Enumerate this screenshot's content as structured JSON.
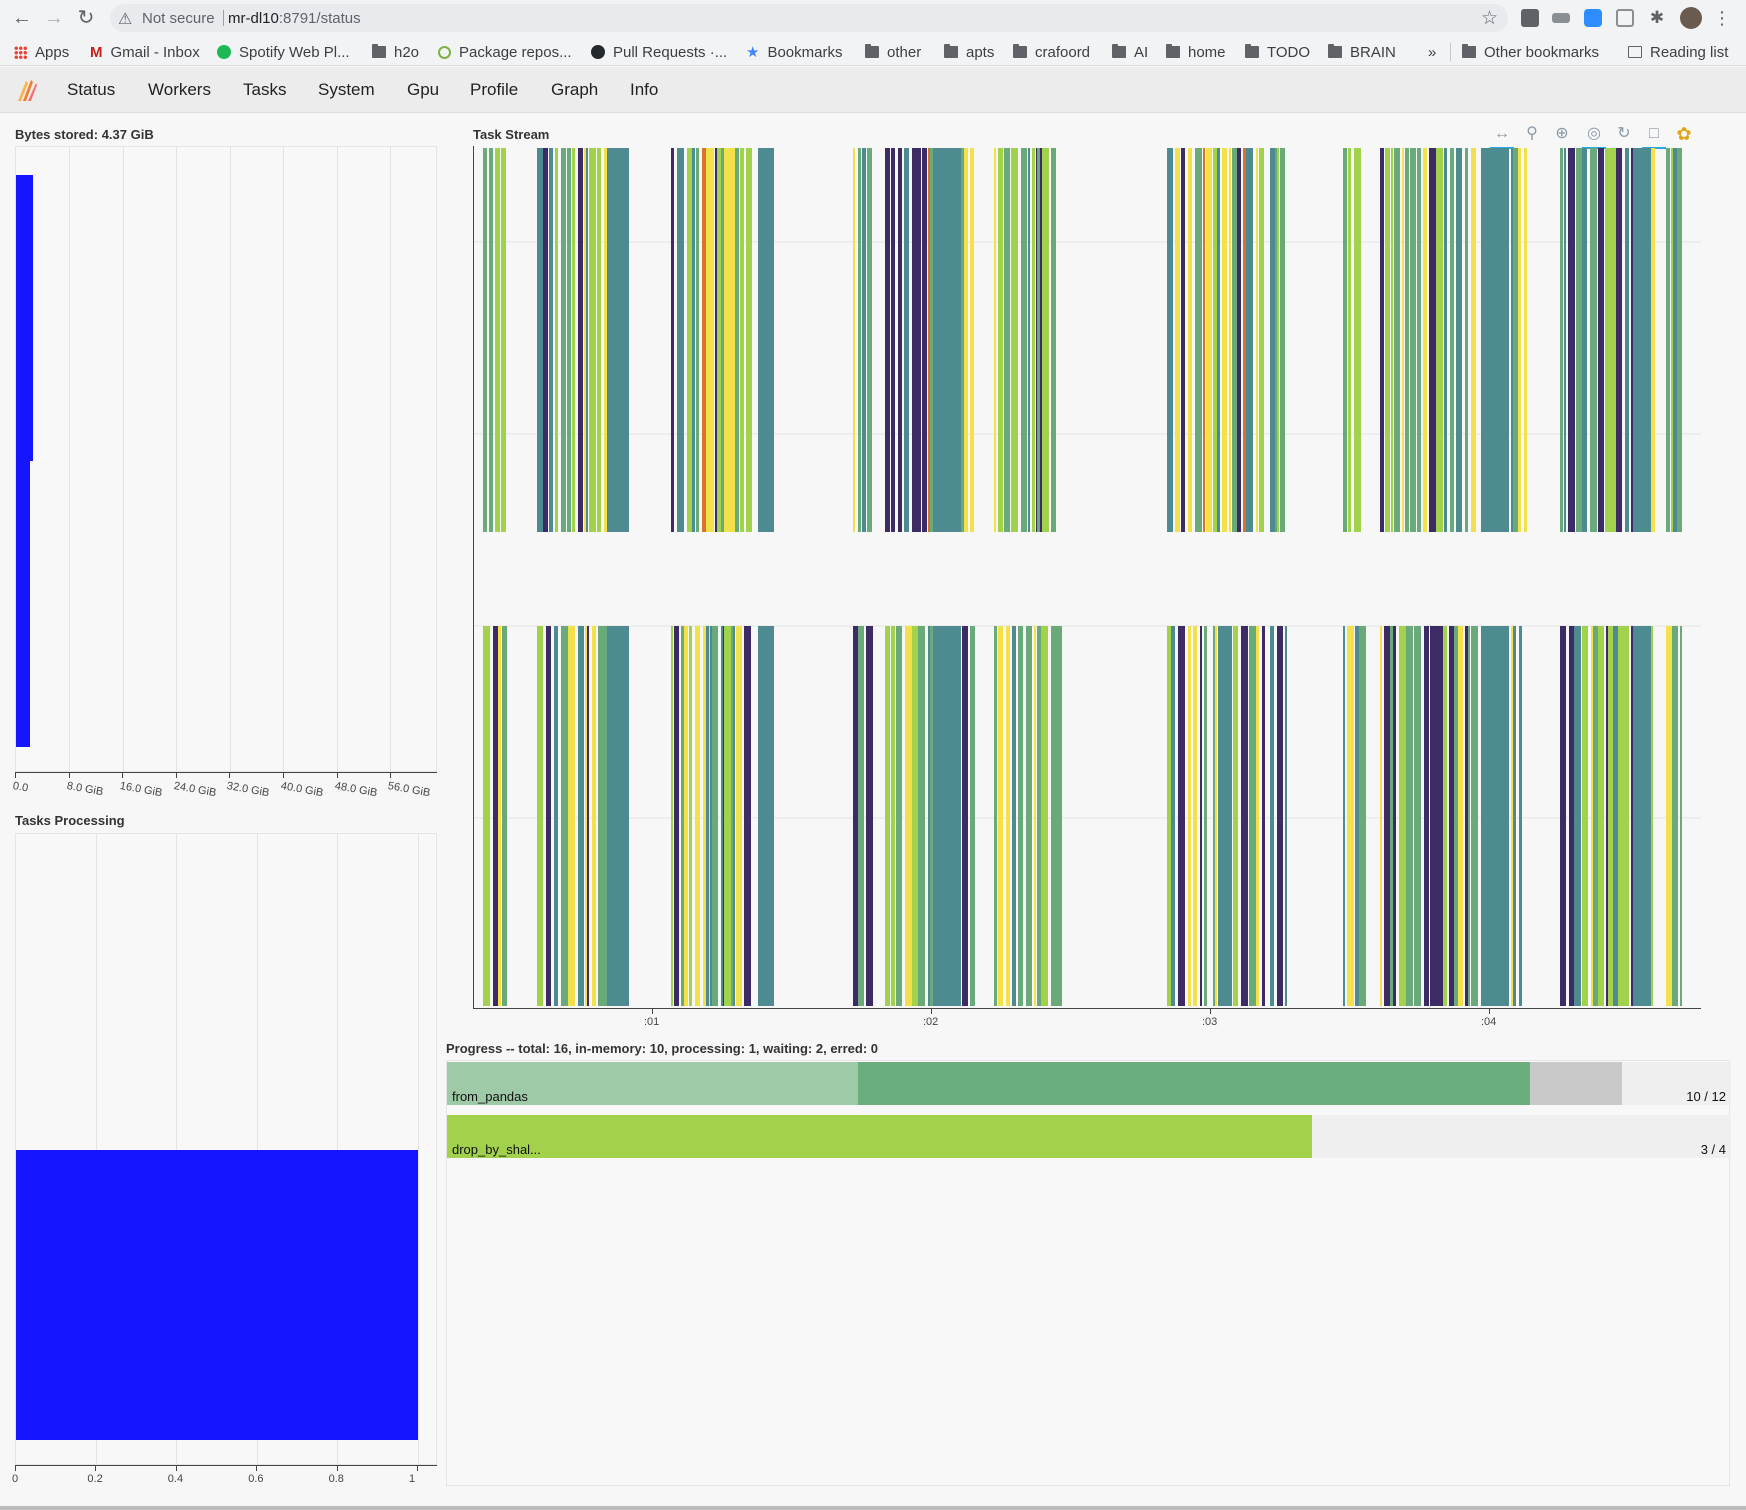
{
  "browser": {
    "back_icon": "back-arrow-icon",
    "warning_label": "Not secure",
    "url_host": "mr-dl10",
    "url_rest": ":8791/status"
  },
  "bookmarks": {
    "items": [
      "Apps",
      "Gmail - Inbox",
      "Spotify Web Pl...",
      "h2o",
      "Package repos...",
      "Pull Requests ·...",
      "Bookmarks",
      "other",
      "apts",
      "crafoord",
      "AI",
      "home",
      "TODO",
      "BRAIN"
    ],
    "overflow": "»",
    "other": "Other bookmarks",
    "reading_list": "Reading list"
  },
  "dask_nav": [
    "Status",
    "Workers",
    "Tasks",
    "System",
    "Gpu",
    "Profile",
    "Graph",
    "Info"
  ],
  "bytes_stored": {
    "title": "Bytes stored: 4.37 GiB",
    "ticks": [
      "0.0",
      "8.0 GiB",
      "16.0 GiB",
      "24.0 GiB",
      "32.0 GiB",
      "40.0 GiB",
      "48.0 GiB",
      "56.0 GiB"
    ],
    "bar_color": "#1515ff"
  },
  "tasks_processing": {
    "title": "Tasks Processing",
    "ticks": [
      "0",
      "0.2",
      "0.4",
      "0.6",
      "0.8",
      "1"
    ],
    "value": 1,
    "bar_color": "#1515ff"
  },
  "task_stream": {
    "title": "Task Stream",
    "ticks": [
      ":01",
      ":02",
      ":03",
      ":04"
    ],
    "colors": [
      "#6aa97a",
      "#a2d14b",
      "#4e8b91",
      "#3d2b66",
      "#f3e04a",
      "#d9732a"
    ]
  },
  "progress": {
    "header": "Progress -- total: 16, in-memory: 10, processing: 1, waiting: 2, erred: 0",
    "rows": [
      {
        "name": "from_pandas",
        "count": "10 / 12",
        "released": 0.2,
        "memory": 0.5238,
        "processing": 0.0714
      },
      {
        "name": "drop_by_shal...",
        "count": "3 / 4",
        "released": 0.0,
        "memory": 0.6735,
        "processing": 0.0
      }
    ],
    "colors": {
      "released_a": "#9fcaa8",
      "memory_a": "#6aae7e",
      "processing": "#c9c9c9",
      "memory_b": "#a2d14b"
    }
  }
}
